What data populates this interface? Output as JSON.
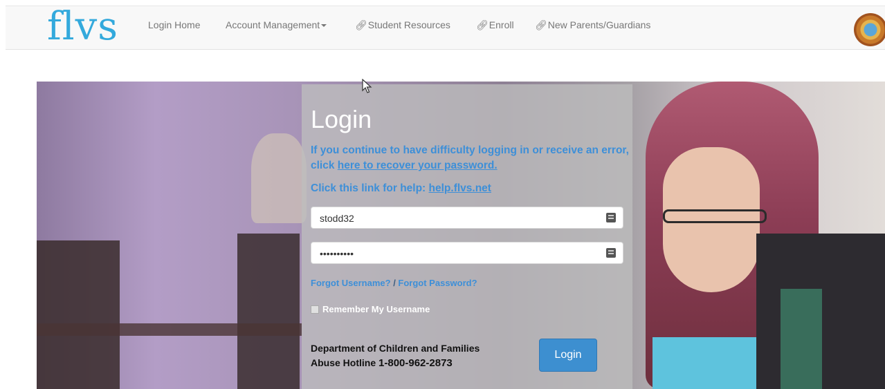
{
  "brand": {
    "logo_text": "flvs",
    "color": "#33a9dc"
  },
  "nav": {
    "items": [
      {
        "label": "Login Home",
        "icon": null
      },
      {
        "label": "Account Management",
        "icon": "caret-down-icon"
      },
      {
        "label": "Student Resources",
        "icon": "link-icon"
      },
      {
        "label": "Enroll",
        "icon": "link-icon"
      },
      {
        "label": "New Parents/Guardians",
        "icon": "link-icon"
      }
    ],
    "seal_icon": "florida-state-seal-icon"
  },
  "login": {
    "title": "Login",
    "notice_text": "If you continue to have difficulty logging in or receive an error, click ",
    "notice_link": "here to recover your password.",
    "help_text": "Click this link for help: ",
    "help_link": "help.flvs.net",
    "username_value": "stodd32",
    "password_value": "••••••••••",
    "forgot_username": "Forgot Username?",
    "forgot_separator": " / ",
    "forgot_password": "Forgot Password?",
    "remember_label": "Remember My Username",
    "hotline_line1": "Department of Children and Families",
    "hotline_prefix": "Abuse Hotline ",
    "hotline_phone": "1-800-962-2873",
    "button_label": "Login"
  },
  "colors": {
    "link": "#3d8fd8",
    "button": "#3d8fd0",
    "navbar_bg": "#f8f8f8"
  }
}
